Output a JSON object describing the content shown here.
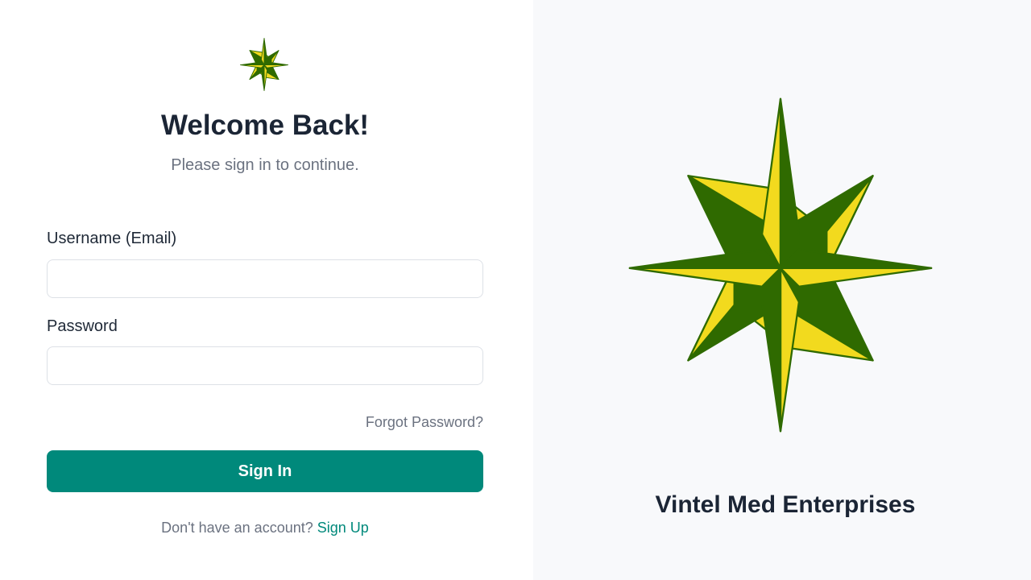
{
  "login": {
    "title": "Welcome Back!",
    "subtitle": "Please sign in to continue.",
    "username_label": "Username (Email)",
    "username_value": "",
    "password_label": "Password",
    "password_value": "",
    "forgot_label": "Forgot Password?",
    "signin_label": "Sign In",
    "signup_prompt": "Don't have an account?",
    "signup_link": "Sign Up"
  },
  "brand": {
    "name": "Vintel Med Enterprises",
    "logo_icon": "compass-star-icon",
    "colors": {
      "green": "#2f6a00",
      "yellow": "#f2da1e",
      "accent": "#00897b"
    }
  }
}
